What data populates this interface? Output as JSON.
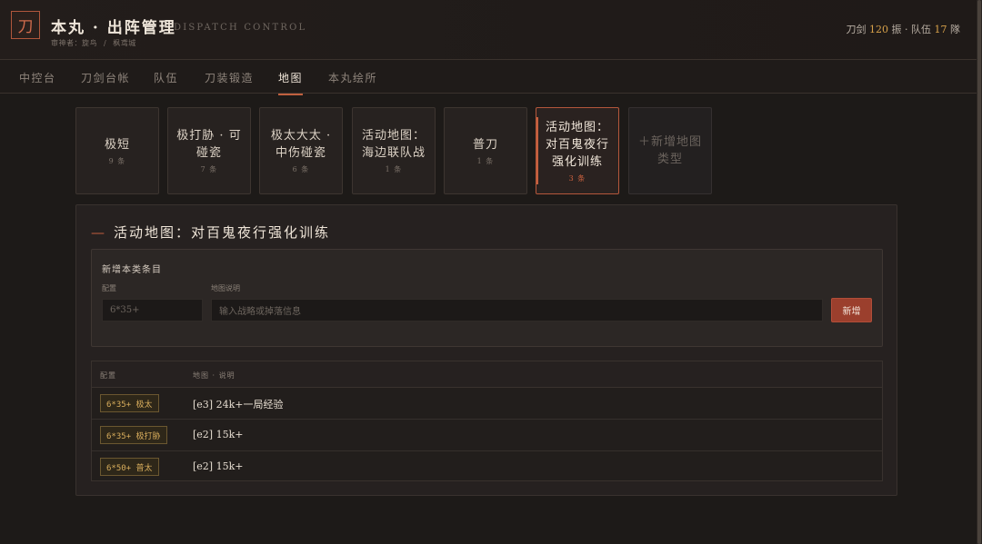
{
  "header": {
    "logo_glyph": "刀",
    "title": "本丸 · 出阵管理",
    "title_en": "DISPATCH CONTROL",
    "saniwa_label": "审神者：",
    "saniwa_name": "旋鸟",
    "separator": "/",
    "citadel_name": "枫鸢城",
    "stats": {
      "swords_label": "刀剑",
      "swords_count": "120",
      "swords_unit": "振",
      "dot": "·",
      "teams_label": "队伍",
      "teams_count": "17",
      "teams_unit": "隊"
    }
  },
  "nav": {
    "items": [
      {
        "label": "中控台"
      },
      {
        "label": "刀剑台帐"
      },
      {
        "label": "队伍"
      },
      {
        "label": "刀装锻造"
      },
      {
        "label": "地图"
      },
      {
        "label": "本丸绘所"
      }
    ],
    "active": "地图"
  },
  "map_types": [
    {
      "name": "极短",
      "count": "9 条"
    },
    {
      "name": "极打胁 · 可碰瓷",
      "count": "7 条"
    },
    {
      "name": "极太大太 · 中伤碰瓷",
      "count": "6 条"
    },
    {
      "name": "活动地图：海边联队战",
      "count": "1 条"
    },
    {
      "name": "普刀",
      "count": "1 条"
    },
    {
      "name": "活动地图：对百鬼夜行强化训练",
      "count": "3 条"
    }
  ],
  "add_type_label": "＋新增地图类型",
  "panel": {
    "dash": "—",
    "title": "活动地图：对百鬼夜行强化训练",
    "form": {
      "title": "新增本类条目",
      "config_label": "配置",
      "config_placeholder": "6*35+",
      "desc_label": "地图说明",
      "desc_placeholder": "输入战略或掉落信息",
      "submit": "新增"
    },
    "table": {
      "col_config": "配置",
      "col_desc": "地图 · 说明",
      "rows": [
        {
          "config": "6*35+ 极太",
          "desc": "[e3] 24k+一局经验"
        },
        {
          "config": "6*35+ 极打胁",
          "desc": "[e2] 15k+"
        },
        {
          "config": "6*50+ 普太",
          "desc": "[e2] 15k+"
        }
      ]
    }
  },
  "colors": {
    "accent": "#c5603f",
    "gold": "#d7a14a",
    "background": "#1d1a18"
  }
}
